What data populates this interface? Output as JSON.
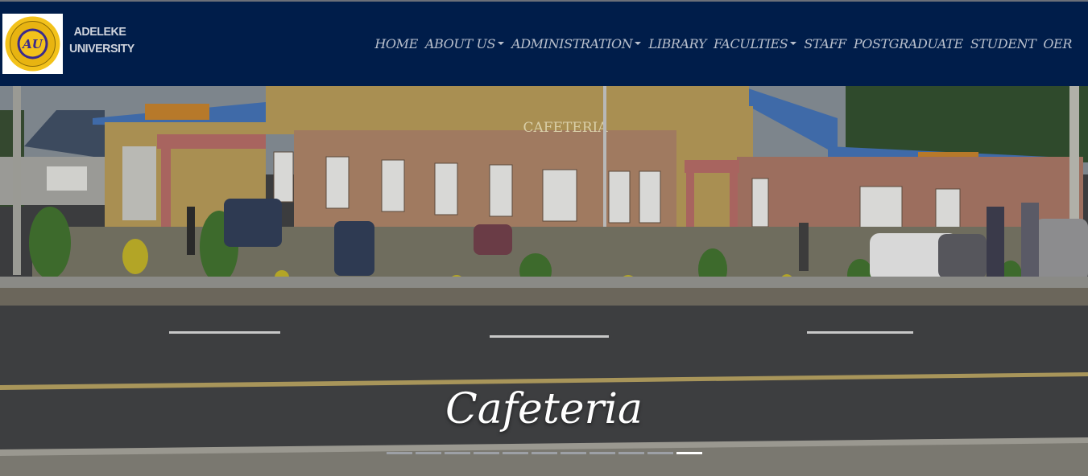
{
  "brand": {
    "line1": "ADELEKE",
    "line2": "UNIVERSITY",
    "seal_text": "ADELEKE UNIVERSITY EDE"
  },
  "nav": {
    "home": "HOME",
    "about": "ABOUT US",
    "administration": "ADMINISTRATION",
    "library": "LIBRARY",
    "faculties": "FACULTIES",
    "staff": "STAFF",
    "postgraduate": "POSTGRADUATE",
    "student": "STUDENT",
    "oer": "OER"
  },
  "carousel": {
    "caption": "Cafeteria",
    "building_sign": "CAFETERIA",
    "slide_count": 11,
    "active_index": 10
  },
  "colors": {
    "navbar": "#001d4a",
    "seal_gold": "#f3c21b",
    "seal_purple": "#3a2a8c"
  }
}
